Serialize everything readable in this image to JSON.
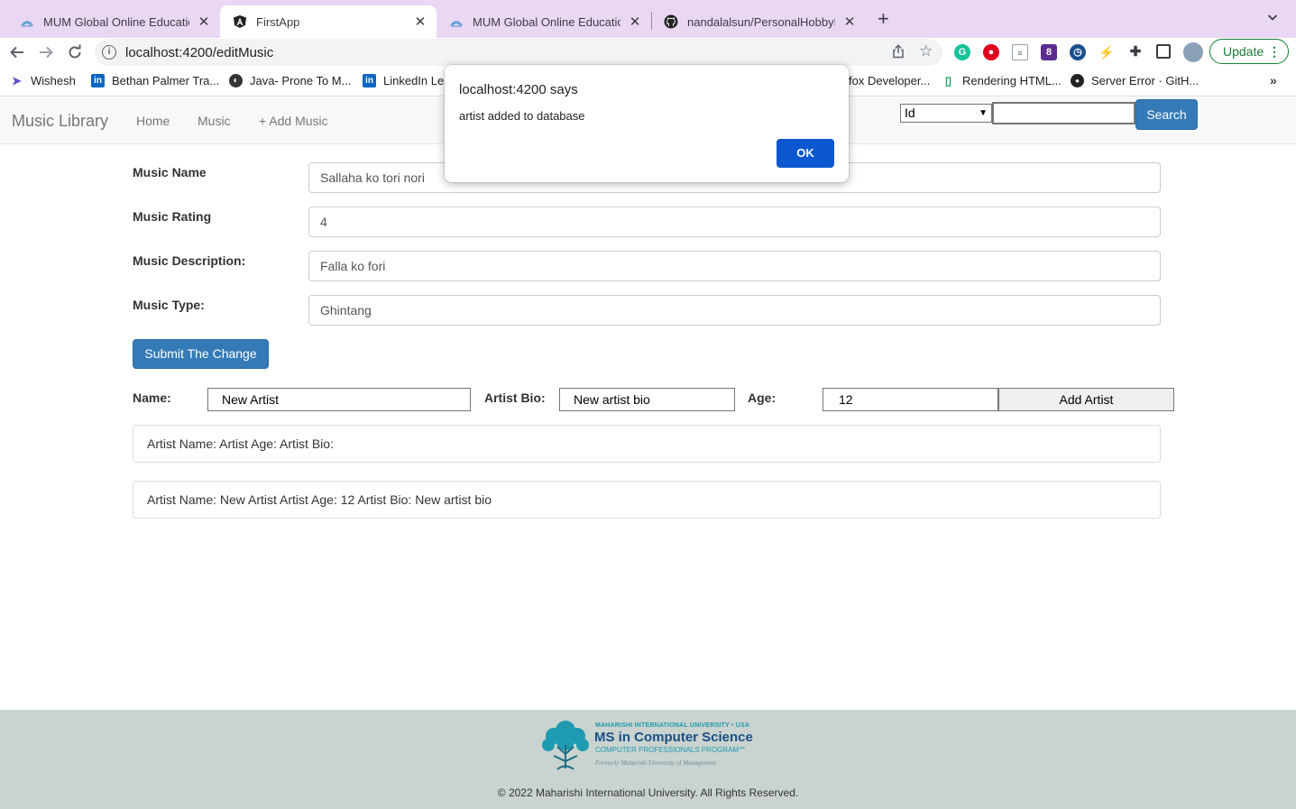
{
  "browser": {
    "tabs": [
      {
        "title": "MUM Global Online Education",
        "icon": "mum-icon"
      },
      {
        "title": "FirstApp",
        "icon": "angular-icon"
      },
      {
        "title": "MUM Global Online Education",
        "icon": "mum-icon"
      },
      {
        "title": "nandalalsun/PersonalHobbyFro",
        "icon": "github-icon"
      }
    ],
    "url": "localhost:4200/editMusic",
    "update_label": "Update",
    "bookmarks": [
      {
        "label": "Wishesh",
        "icon": "send-icon"
      },
      {
        "label": "Bethan Palmer Tra...",
        "icon": "linkedin-icon"
      },
      {
        "label": "Java- Prone To M...",
        "icon": "globe-icon"
      },
      {
        "label": "LinkedIn Lea",
        "icon": "linkedin-icon"
      },
      {
        "label": "fox Developer...",
        "icon": "firefox-icon"
      },
      {
        "label": "Rendering HTML...",
        "icon": "doc-icon"
      },
      {
        "label": "Server Error · GitH...",
        "icon": "github-icon"
      }
    ]
  },
  "navbar": {
    "brand": "Music Library",
    "links": [
      "Home",
      "Music",
      "+ Add Music"
    ],
    "search_select": "Id",
    "search_button": "Search"
  },
  "form": {
    "fields": [
      {
        "label": "Music Name",
        "value": "Sallaha ko tori nori"
      },
      {
        "label": "Music Rating",
        "value": "4"
      },
      {
        "label": "Music Description:",
        "value": "Falla ko fori"
      },
      {
        "label": "Music Type:",
        "value": "Ghintang"
      }
    ],
    "submit_label": "Submit The Change"
  },
  "artist_form": {
    "name_label": "Name:",
    "name_value": "New Artist",
    "bio_label": "Artist Bio:",
    "bio_value": "New artist bio",
    "age_label": "Age:",
    "age_value": "12",
    "add_button": "Add Artist"
  },
  "artist_list": [
    "Artist Name: Artist Age: Artist Bio:",
    "Artist Name: New Artist Artist Age: 12 Artist Bio: New artist bio"
  ],
  "footer": {
    "logo": {
      "line1": "MAHARISHI INTERNATIONAL UNIVERSITY • USA",
      "line2": "MS in Computer Science",
      "line3": "COMPUTER PROFESSIONALS PROGRAM℠",
      "line4": "Formerly Maharishi University of Management"
    },
    "copyright": "© 2022 Maharishi International University. All Rights Reserved."
  },
  "dialog": {
    "title": "localhost:4200 says",
    "message": "artist added to database",
    "ok_label": "OK"
  }
}
